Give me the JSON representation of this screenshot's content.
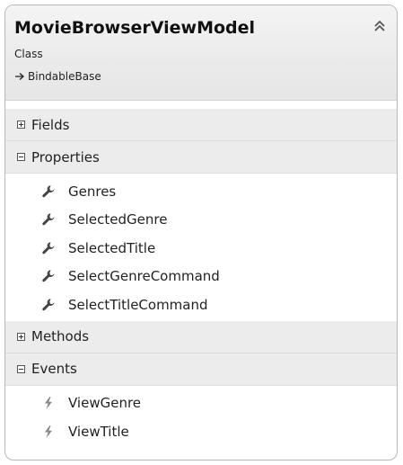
{
  "class": {
    "name": "MovieBrowserViewModel",
    "kind": "Class",
    "base": "BindableBase"
  },
  "sections": {
    "fields": {
      "label": "Fields",
      "expanded": false
    },
    "properties": {
      "label": "Properties",
      "expanded": true,
      "items": [
        "Genres",
        "SelectedGenre",
        "SelectedTitle",
        "SelectGenreCommand",
        "SelectTitleCommand"
      ]
    },
    "methods": {
      "label": "Methods",
      "expanded": false
    },
    "events": {
      "label": "Events",
      "expanded": true,
      "items": [
        "ViewGenre",
        "ViewTitle"
      ]
    }
  },
  "icons": {
    "collapse": "double-chevron-up-icon",
    "inherit": "inheritance-arrow-icon",
    "expand": "plus-box-icon",
    "collapse_section": "minus-box-icon",
    "property": "wrench-icon",
    "event": "lightning-icon"
  },
  "colors": {
    "header_bg": "#ececec",
    "border": "#b8b8b8",
    "icon": "#444444"
  }
}
